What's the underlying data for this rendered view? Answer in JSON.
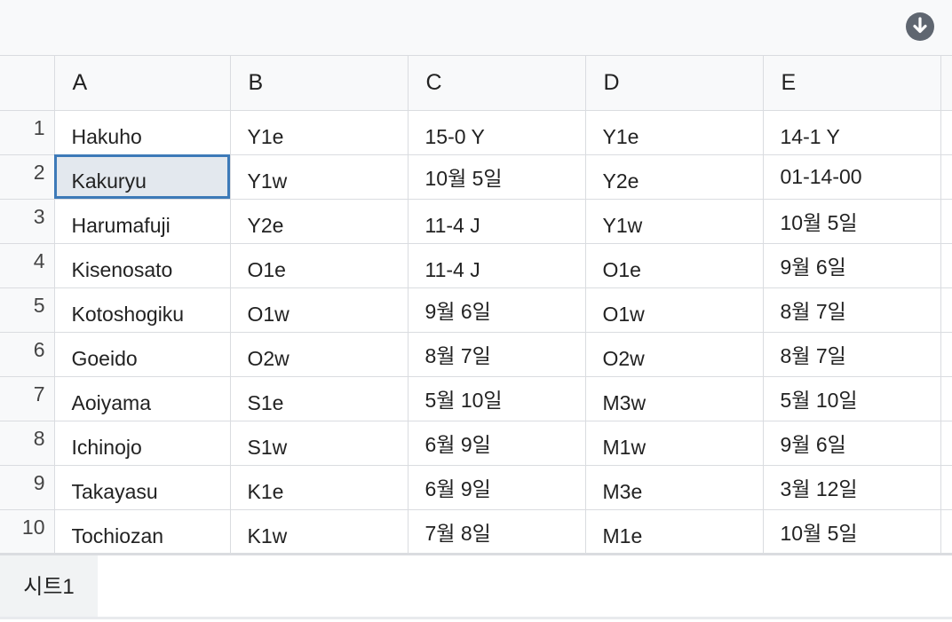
{
  "toolbar": {
    "download_icon": "download-circle-icon"
  },
  "columns": [
    "A",
    "B",
    "C",
    "D",
    "E"
  ],
  "rows": [
    {
      "num": "1",
      "cells": [
        "Hakuho",
        "Y1e",
        "15-0 Y",
        "Y1e",
        "14-1 Y"
      ]
    },
    {
      "num": "2",
      "cells": [
        "Kakuryu",
        "Y1w",
        "10월 5일",
        "Y2e",
        "01-14-00"
      ]
    },
    {
      "num": "3",
      "cells": [
        "Harumafuji",
        "Y2e",
        "11-4 J",
        "Y1w",
        "10월 5일"
      ]
    },
    {
      "num": "4",
      "cells": [
        "Kisenosato",
        "O1e",
        "11-4 J",
        "O1e",
        "9월 6일"
      ]
    },
    {
      "num": "5",
      "cells": [
        "Kotoshogiku",
        "O1w",
        "9월 6일",
        "O1w",
        "8월 7일"
      ]
    },
    {
      "num": "6",
      "cells": [
        "Goeido",
        "O2w",
        "8월 7일",
        "O2w",
        "8월 7일"
      ]
    },
    {
      "num": "7",
      "cells": [
        "Aoiyama",
        "S1e",
        "5월 10일",
        "M3w",
        "5월 10일"
      ]
    },
    {
      "num": "8",
      "cells": [
        "Ichinojo",
        "S1w",
        "6월 9일",
        "M1w",
        "9월 6일"
      ]
    },
    {
      "num": "9",
      "cells": [
        "Takayasu",
        "K1e",
        "6월 9일",
        "M3e",
        "3월 12일"
      ]
    },
    {
      "num": "10",
      "cells": [
        "Tochiozan",
        "K1w",
        "7월 8일",
        "M1e",
        "10월 5일"
      ]
    }
  ],
  "selected_cell": "A2",
  "sheet_tabs": [
    {
      "label": "시트1",
      "active": true
    }
  ],
  "colors": {
    "selection_border": "#3d7ab8",
    "selection_fill": "#e3e8ee",
    "header_bg": "#f8f9fa"
  }
}
